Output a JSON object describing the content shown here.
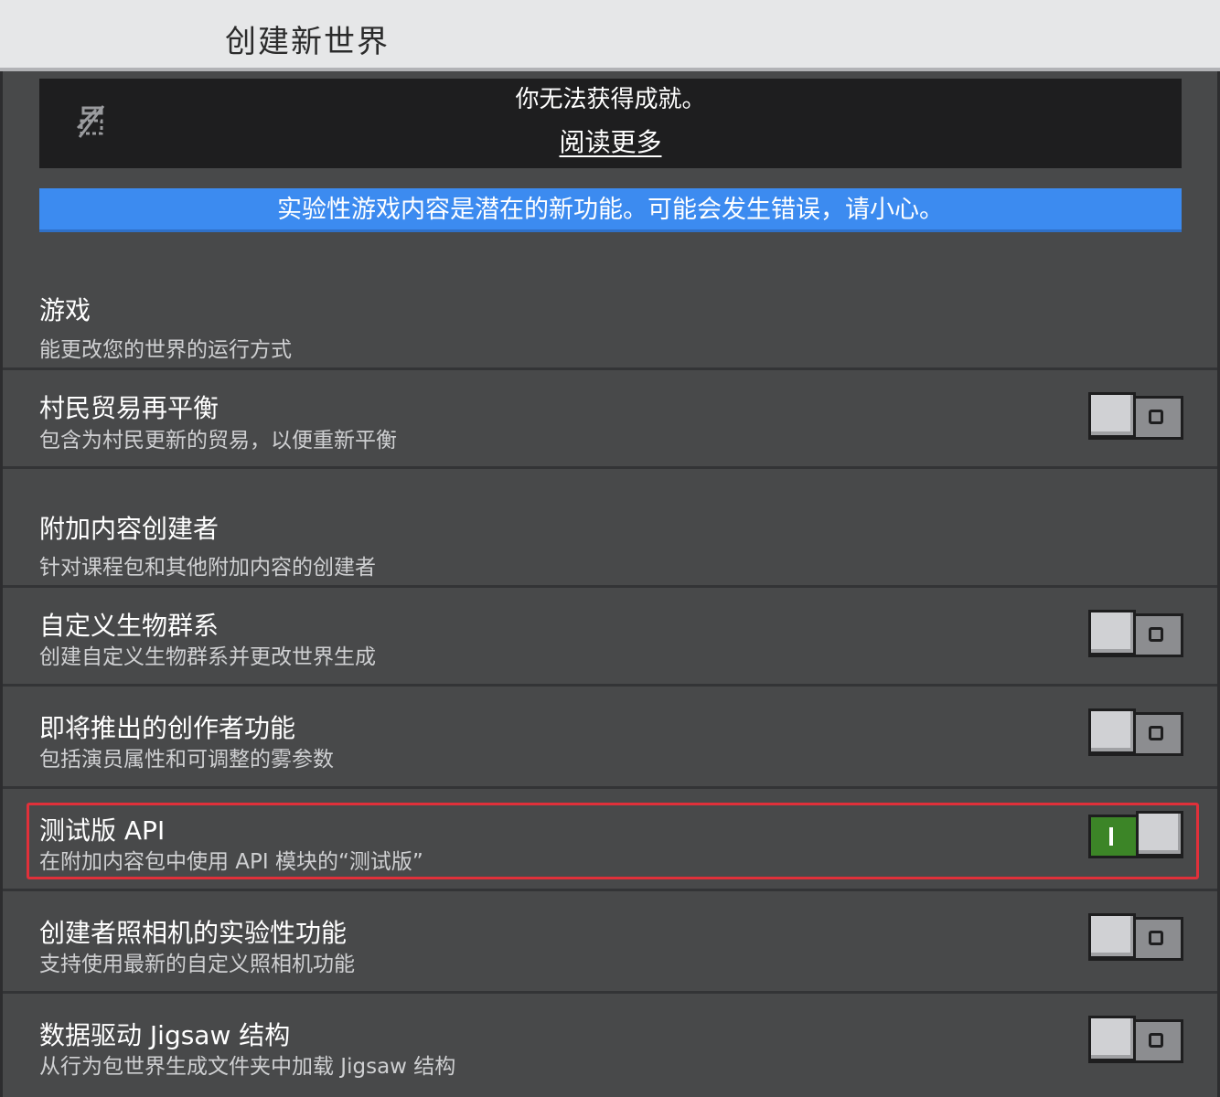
{
  "header": {
    "title": "创建新世界"
  },
  "notice": {
    "text": "你无法获得成就。",
    "link": "阅读更多",
    "icon": "achievement-disabled-icon"
  },
  "warning": {
    "text": "实验性游戏内容是潜在的新功能。可能会发生错误，请小心。"
  },
  "sections": [
    {
      "title": "游戏",
      "desc": "能更改您的世界的运行方式"
    },
    {
      "title": "附加内容创建者",
      "desc": "针对课程包和其他附加内容的创建者"
    }
  ],
  "toggles": [
    {
      "title": "村民贸易再平衡",
      "desc": "包含为村民更新的贸易，以便重新平衡",
      "state": "off"
    },
    {
      "title": "自定义生物群系",
      "desc": "创建自定义生物群系并更改世界生成",
      "state": "off"
    },
    {
      "title": "即将推出的创作者功能",
      "desc": "包括演员属性和可调整的雾参数",
      "state": "off"
    },
    {
      "title": "测试版 API",
      "desc": "在附加内容包中使用 API 模块的“测试版”",
      "state": "on"
    },
    {
      "title": "创建者照相机的实验性功能",
      "desc": "支持使用最新的自定义照相机功能",
      "state": "off"
    },
    {
      "title": "数据驱动 Jigsaw 结构",
      "desc": "从行为包世界生成文件夹中加载 Jigsaw 结构",
      "state": "off"
    }
  ],
  "colors": {
    "toggle_on": "#3c8527",
    "warning_banner": "#3c8bf0",
    "highlight": "#e0303a"
  }
}
